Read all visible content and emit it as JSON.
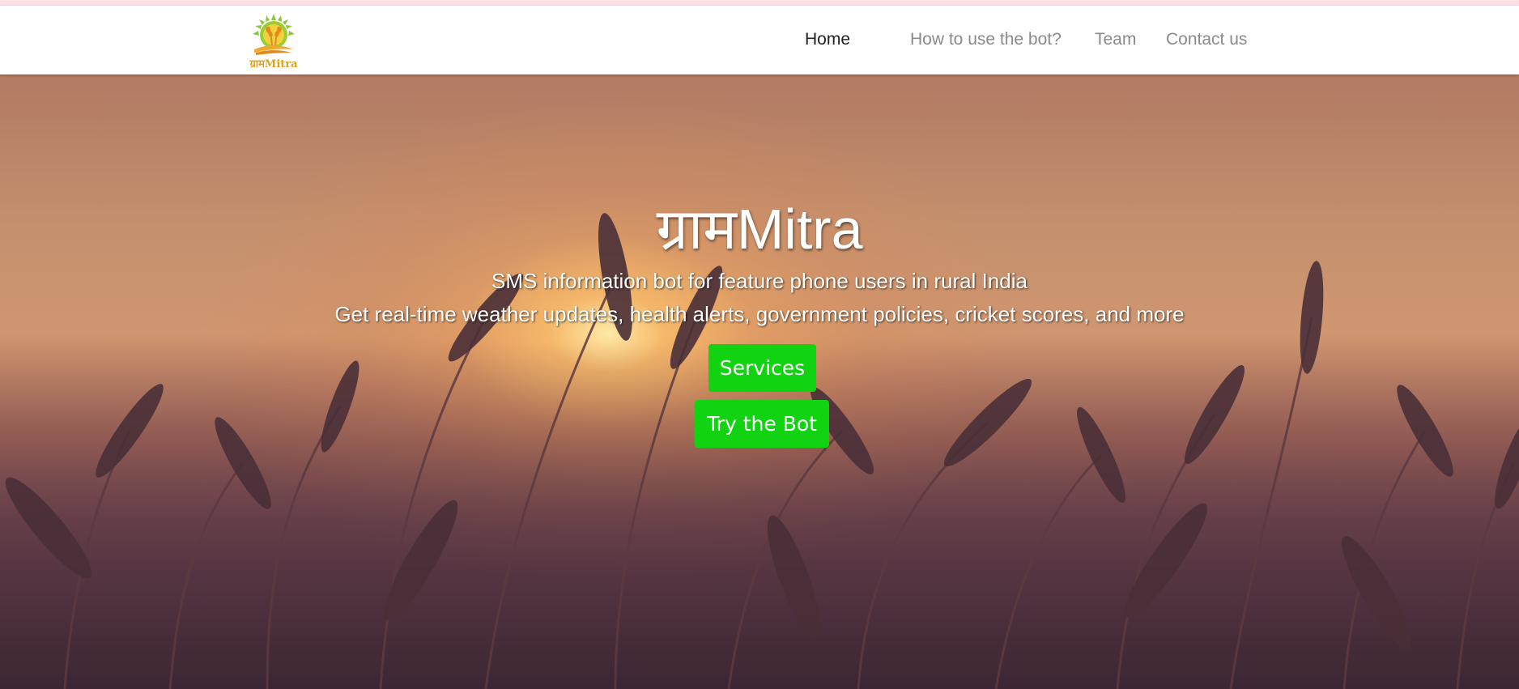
{
  "topbar": {
    "accent_color": "#fde1e6"
  },
  "navbar": {
    "logo": {
      "text": "ग्रामMitra",
      "icon": "wheat-sun-logo"
    },
    "items": [
      {
        "label": "Home",
        "active": true
      },
      {
        "label": "How to use the bot?",
        "active": false
      },
      {
        "label": "Team",
        "active": false
      },
      {
        "label": "Contact us",
        "active": false
      }
    ]
  },
  "hero": {
    "title": "ग्रामMitra",
    "subtitle_line1": "SMS information bot for feature phone users in rural India",
    "subtitle_line2": "Get real-time weather updates, health alerts, government policies, cricket scores, and more",
    "buttons": {
      "services_label": "Services",
      "try_bot_label": "Try the Bot"
    },
    "button_color": "#12d312",
    "background_image": "wheat-field-sunset"
  }
}
